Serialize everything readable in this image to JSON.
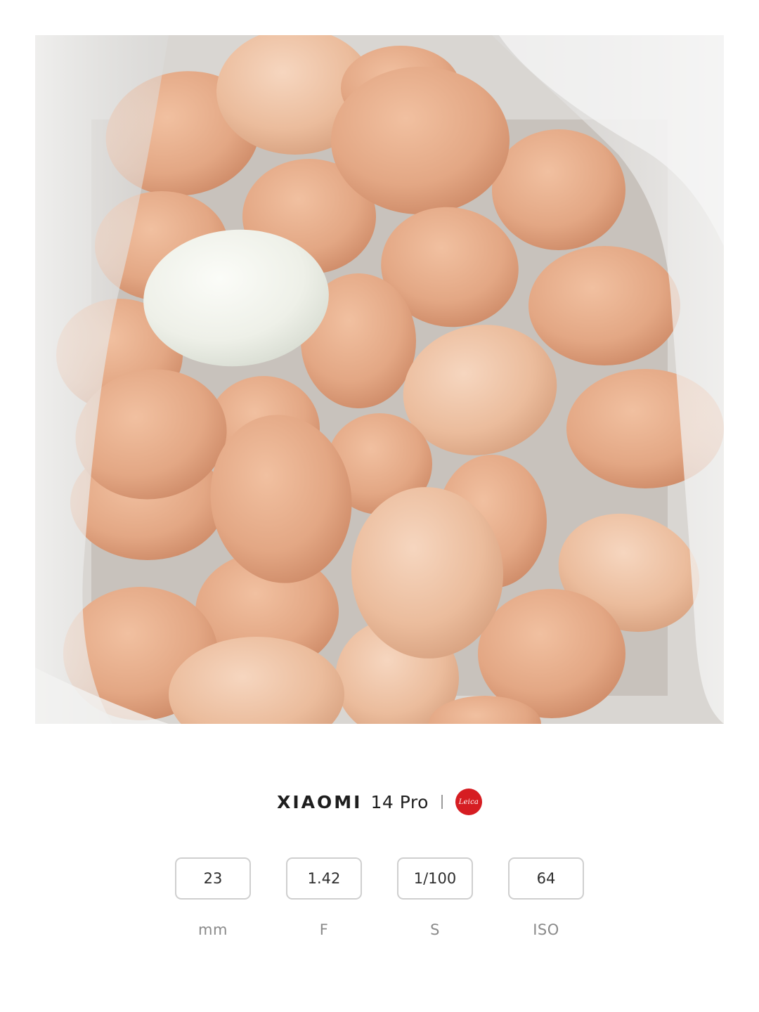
{
  "brand": {
    "name": "XIAOMI",
    "model": "14 Pro",
    "logo_text": "Leica",
    "logo_color": "#d61d22"
  },
  "specs": [
    {
      "value": "23",
      "unit": "mm"
    },
    {
      "value": "1.42",
      "unit": "F"
    },
    {
      "value": "1/100",
      "unit": "S"
    },
    {
      "value": "64",
      "unit": "ISO"
    }
  ],
  "colors": {
    "background": "#ffffff",
    "box_border": "#cfcfcf",
    "unit_text": "#8a8a8a",
    "egg_brown": "#e3a784",
    "egg_white": "#eef0e8"
  }
}
